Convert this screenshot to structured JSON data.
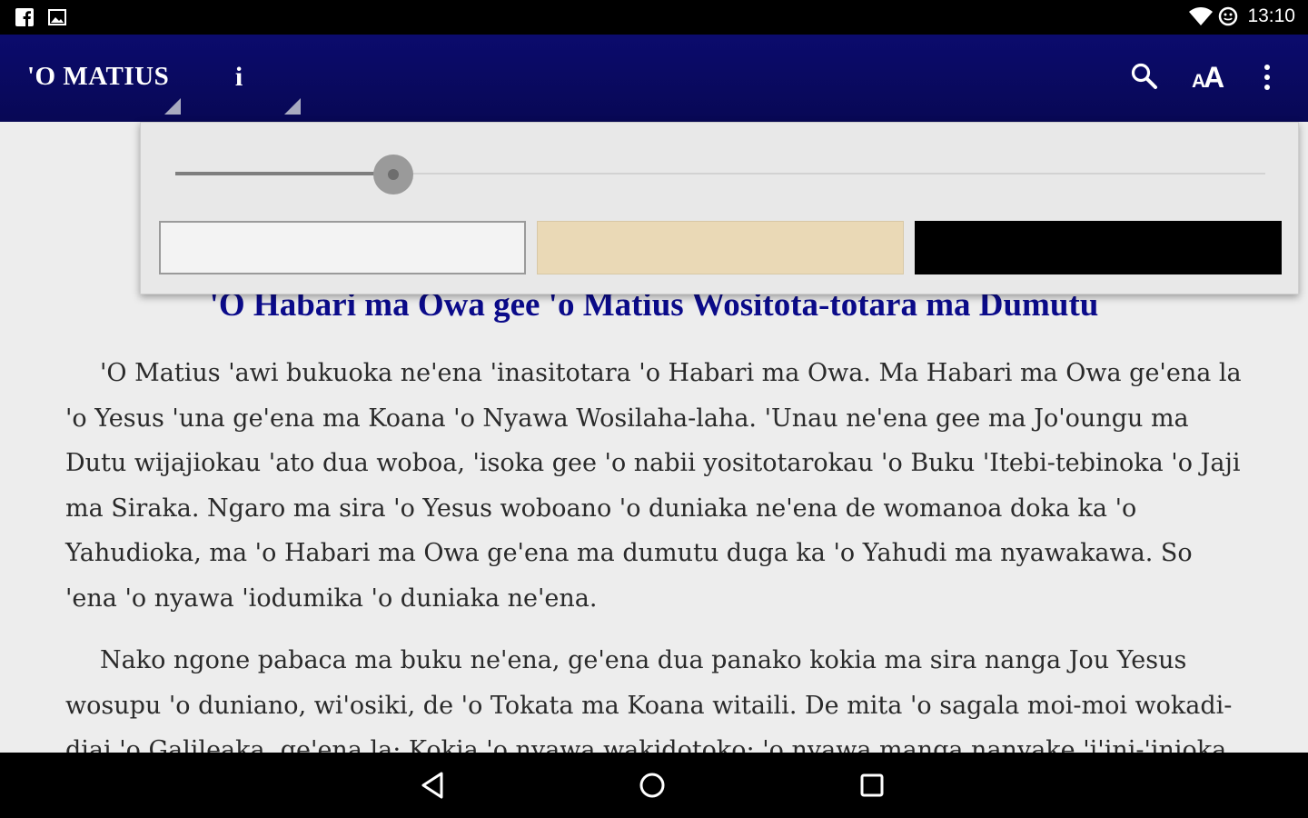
{
  "status_bar": {
    "time": "13:10",
    "icons": [
      "facebook-notification-icon",
      "image-notification-icon",
      "wifi-icon",
      "data-saver-icon"
    ]
  },
  "app_bar": {
    "book_title": "'O MATIUS",
    "info_label": "i",
    "icons": [
      "search-icon",
      "text-size-icon",
      "overflow-menu-icon"
    ]
  },
  "text_settings": {
    "font_size_level": 0.2,
    "themes": [
      {
        "name": "light",
        "color": "#f3f3f3"
      },
      {
        "name": "sepia",
        "color": "#ead9b6"
      },
      {
        "name": "dark",
        "color": "#000000"
      }
    ]
  },
  "content": {
    "heading": "'O Habari ma Owa gee 'o Matius Wositota-totara ma Dumutu",
    "paragraphs": [
      "'O Matius 'awi bukuoka ne'ena 'inasitotara 'o Habari ma Owa. Ma Habari ma Owa ge'ena la 'o Yesus 'una ge'ena ma Koana 'o Nyawa Wosilaha-laha. 'Unau ne'ena gee ma Jo'oungu ma Dutu wijajiokau 'ato dua woboa, 'isoka gee 'o nabii yositotarokau 'o Buku 'Itebi-tebinoka 'o Jaji ma Siraka. Ngaro ma sira 'o Yesus woboano 'o duniaka ne'ena de womanoa doka ka 'o Yahudioka, ma 'o Habari ma Owa ge'ena ma dumutu duga ka 'o Yahudi ma nyawakawa. So 'ena 'o nyawa 'iodumika 'o duniaka ne'ena.",
      "Nako ngone pabaca ma buku ne'ena, ge'ena dua panako kokia ma sira nanga Jou Yesus wosupu 'o duniano, wi'osiki, de 'o Tokata ma Koana witaili. De mita 'o sagala moi-moi wokadi-diai 'o Galileaka, ge'ena la: Kokia 'o nyawa wakidotoko; 'o nyawa manga nanyake 'i'ini-'inioka"
    ]
  },
  "colors": {
    "app_bar": "#0b0b6d",
    "heading": "#0b0b8a",
    "body_text": "#2a2a2a",
    "background": "#ededed"
  },
  "nav_bar": {
    "icons": [
      "back-icon",
      "home-icon",
      "recents-icon"
    ]
  }
}
